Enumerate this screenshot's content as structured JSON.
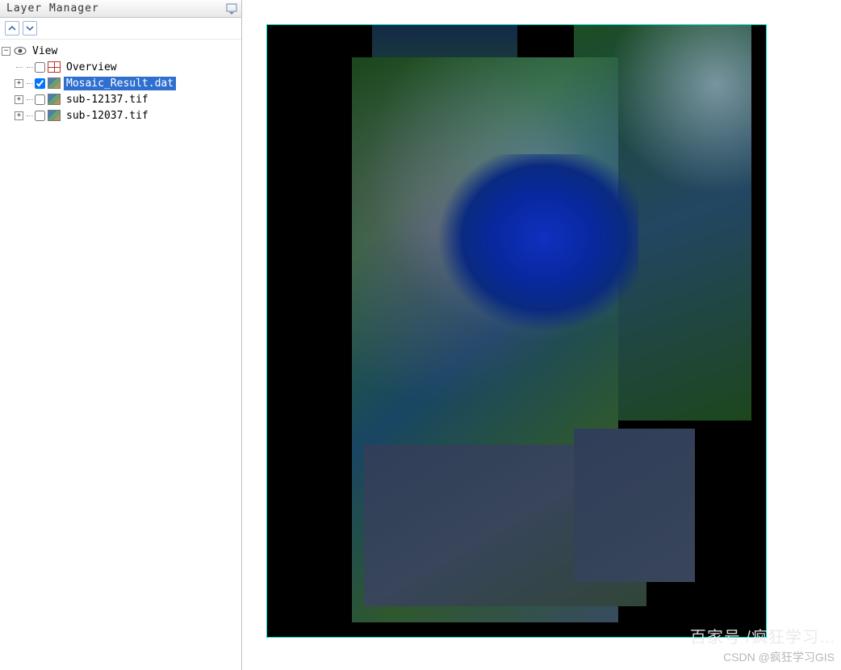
{
  "panel": {
    "title": "Layer Manager"
  },
  "tree": {
    "root": {
      "label": "View"
    },
    "items": [
      {
        "label": "Overview",
        "checked": false,
        "selected": false,
        "icon": "overview",
        "expandable": false
      },
      {
        "label": "Mosaic_Result.dat",
        "checked": true,
        "selected": true,
        "icon": "raster",
        "expandable": true
      },
      {
        "label": "sub-12137.tif",
        "checked": false,
        "selected": false,
        "icon": "raster",
        "expandable": true
      },
      {
        "label": "sub-12037.tif",
        "checked": false,
        "selected": false,
        "icon": "raster",
        "expandable": true
      }
    ]
  },
  "watermark": {
    "line1": "百家号 /疯狂学习…",
    "line2": "CSDN @疯狂学习GIS"
  }
}
